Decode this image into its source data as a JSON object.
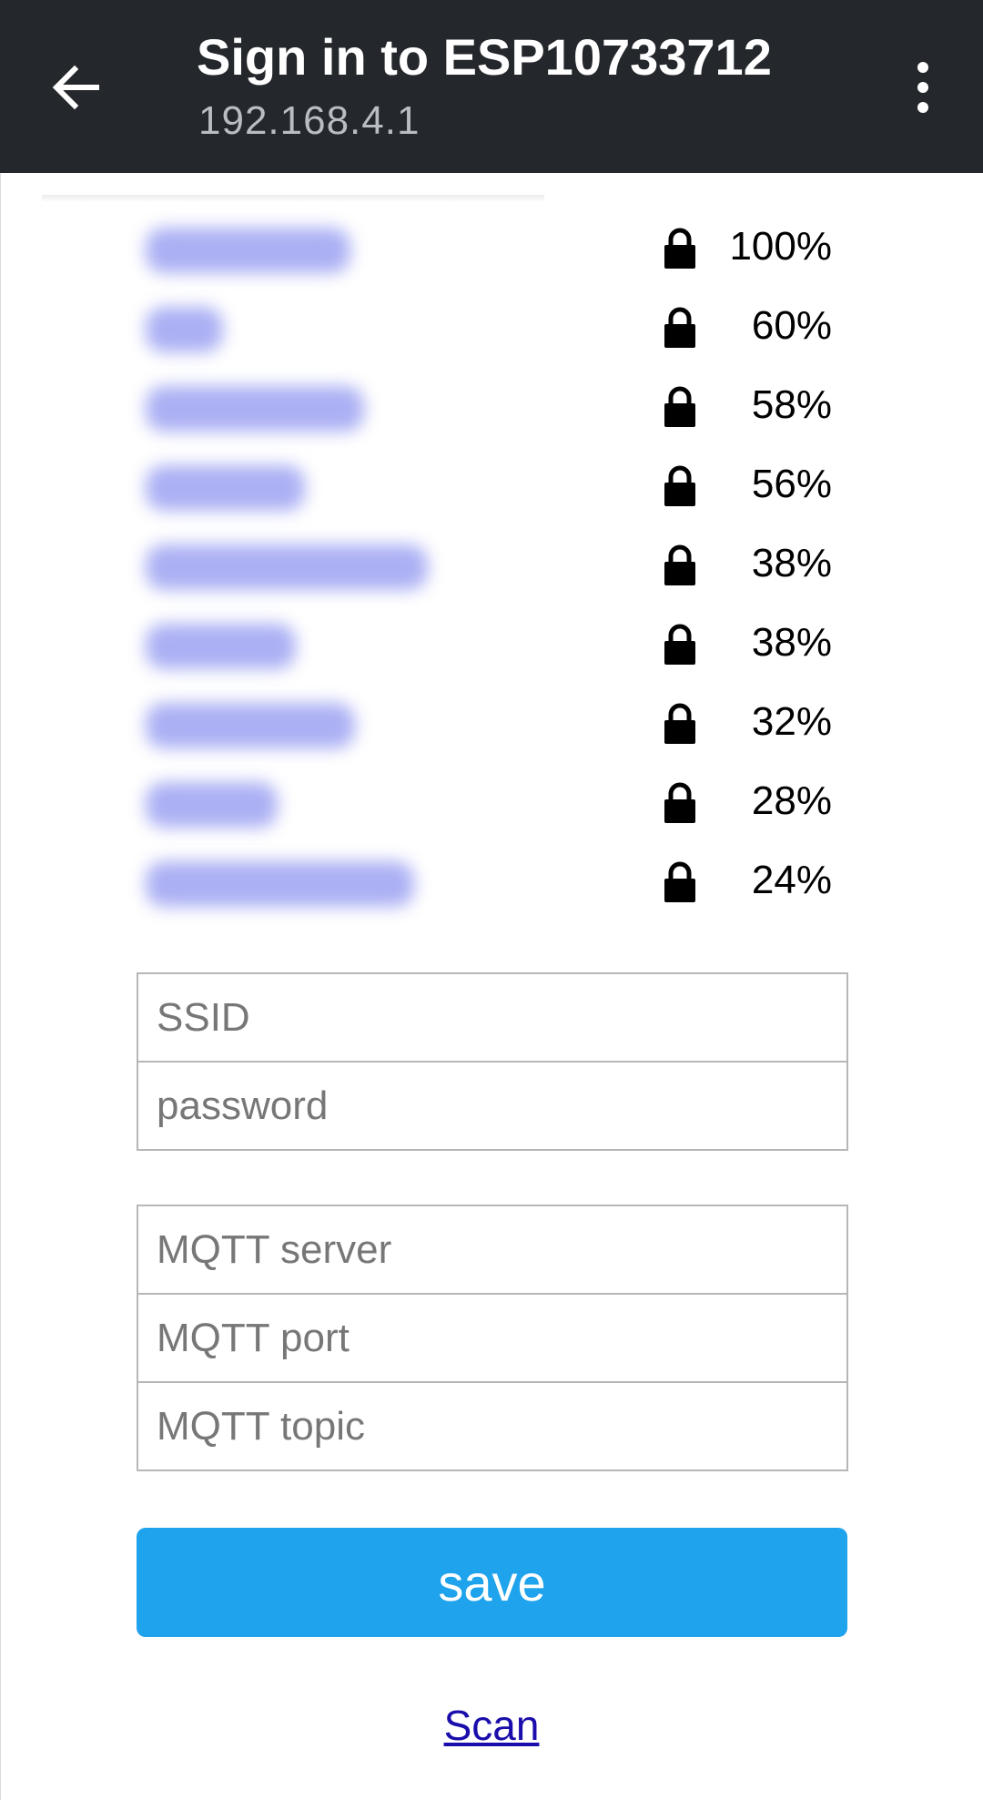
{
  "appbar": {
    "title": "Sign in to ESP10733712",
    "subtitle": "192.168.4.1",
    "back_icon": "arrow-left-icon",
    "menu_icon": "more-vert-icon",
    "background": "#24272b"
  },
  "networks": [
    {
      "signal": "100%",
      "secured": true,
      "lock_icon": "lock-icon"
    },
    {
      "signal": "60%",
      "secured": true,
      "lock_icon": "lock-icon"
    },
    {
      "signal": "58%",
      "secured": true,
      "lock_icon": "lock-icon"
    },
    {
      "signal": "56%",
      "secured": true,
      "lock_icon": "lock-icon"
    },
    {
      "signal": "38%",
      "secured": true,
      "lock_icon": "lock-icon"
    },
    {
      "signal": "38%",
      "secured": true,
      "lock_icon": "lock-icon"
    },
    {
      "signal": "32%",
      "secured": true,
      "lock_icon": "lock-icon"
    },
    {
      "signal": "28%",
      "secured": true,
      "lock_icon": "lock-icon"
    },
    {
      "signal": "24%",
      "secured": true,
      "lock_icon": "lock-icon"
    }
  ],
  "wifi_form": {
    "ssid_placeholder": "SSID",
    "password_placeholder": "password"
  },
  "mqtt_form": {
    "server_placeholder": "MQTT server",
    "port_placeholder": "MQTT port",
    "topic_placeholder": "MQTT topic"
  },
  "actions": {
    "save_label": "save",
    "save_color": "#1fa3ec",
    "scan_label": "Scan",
    "link_color": "#1a0dab"
  }
}
